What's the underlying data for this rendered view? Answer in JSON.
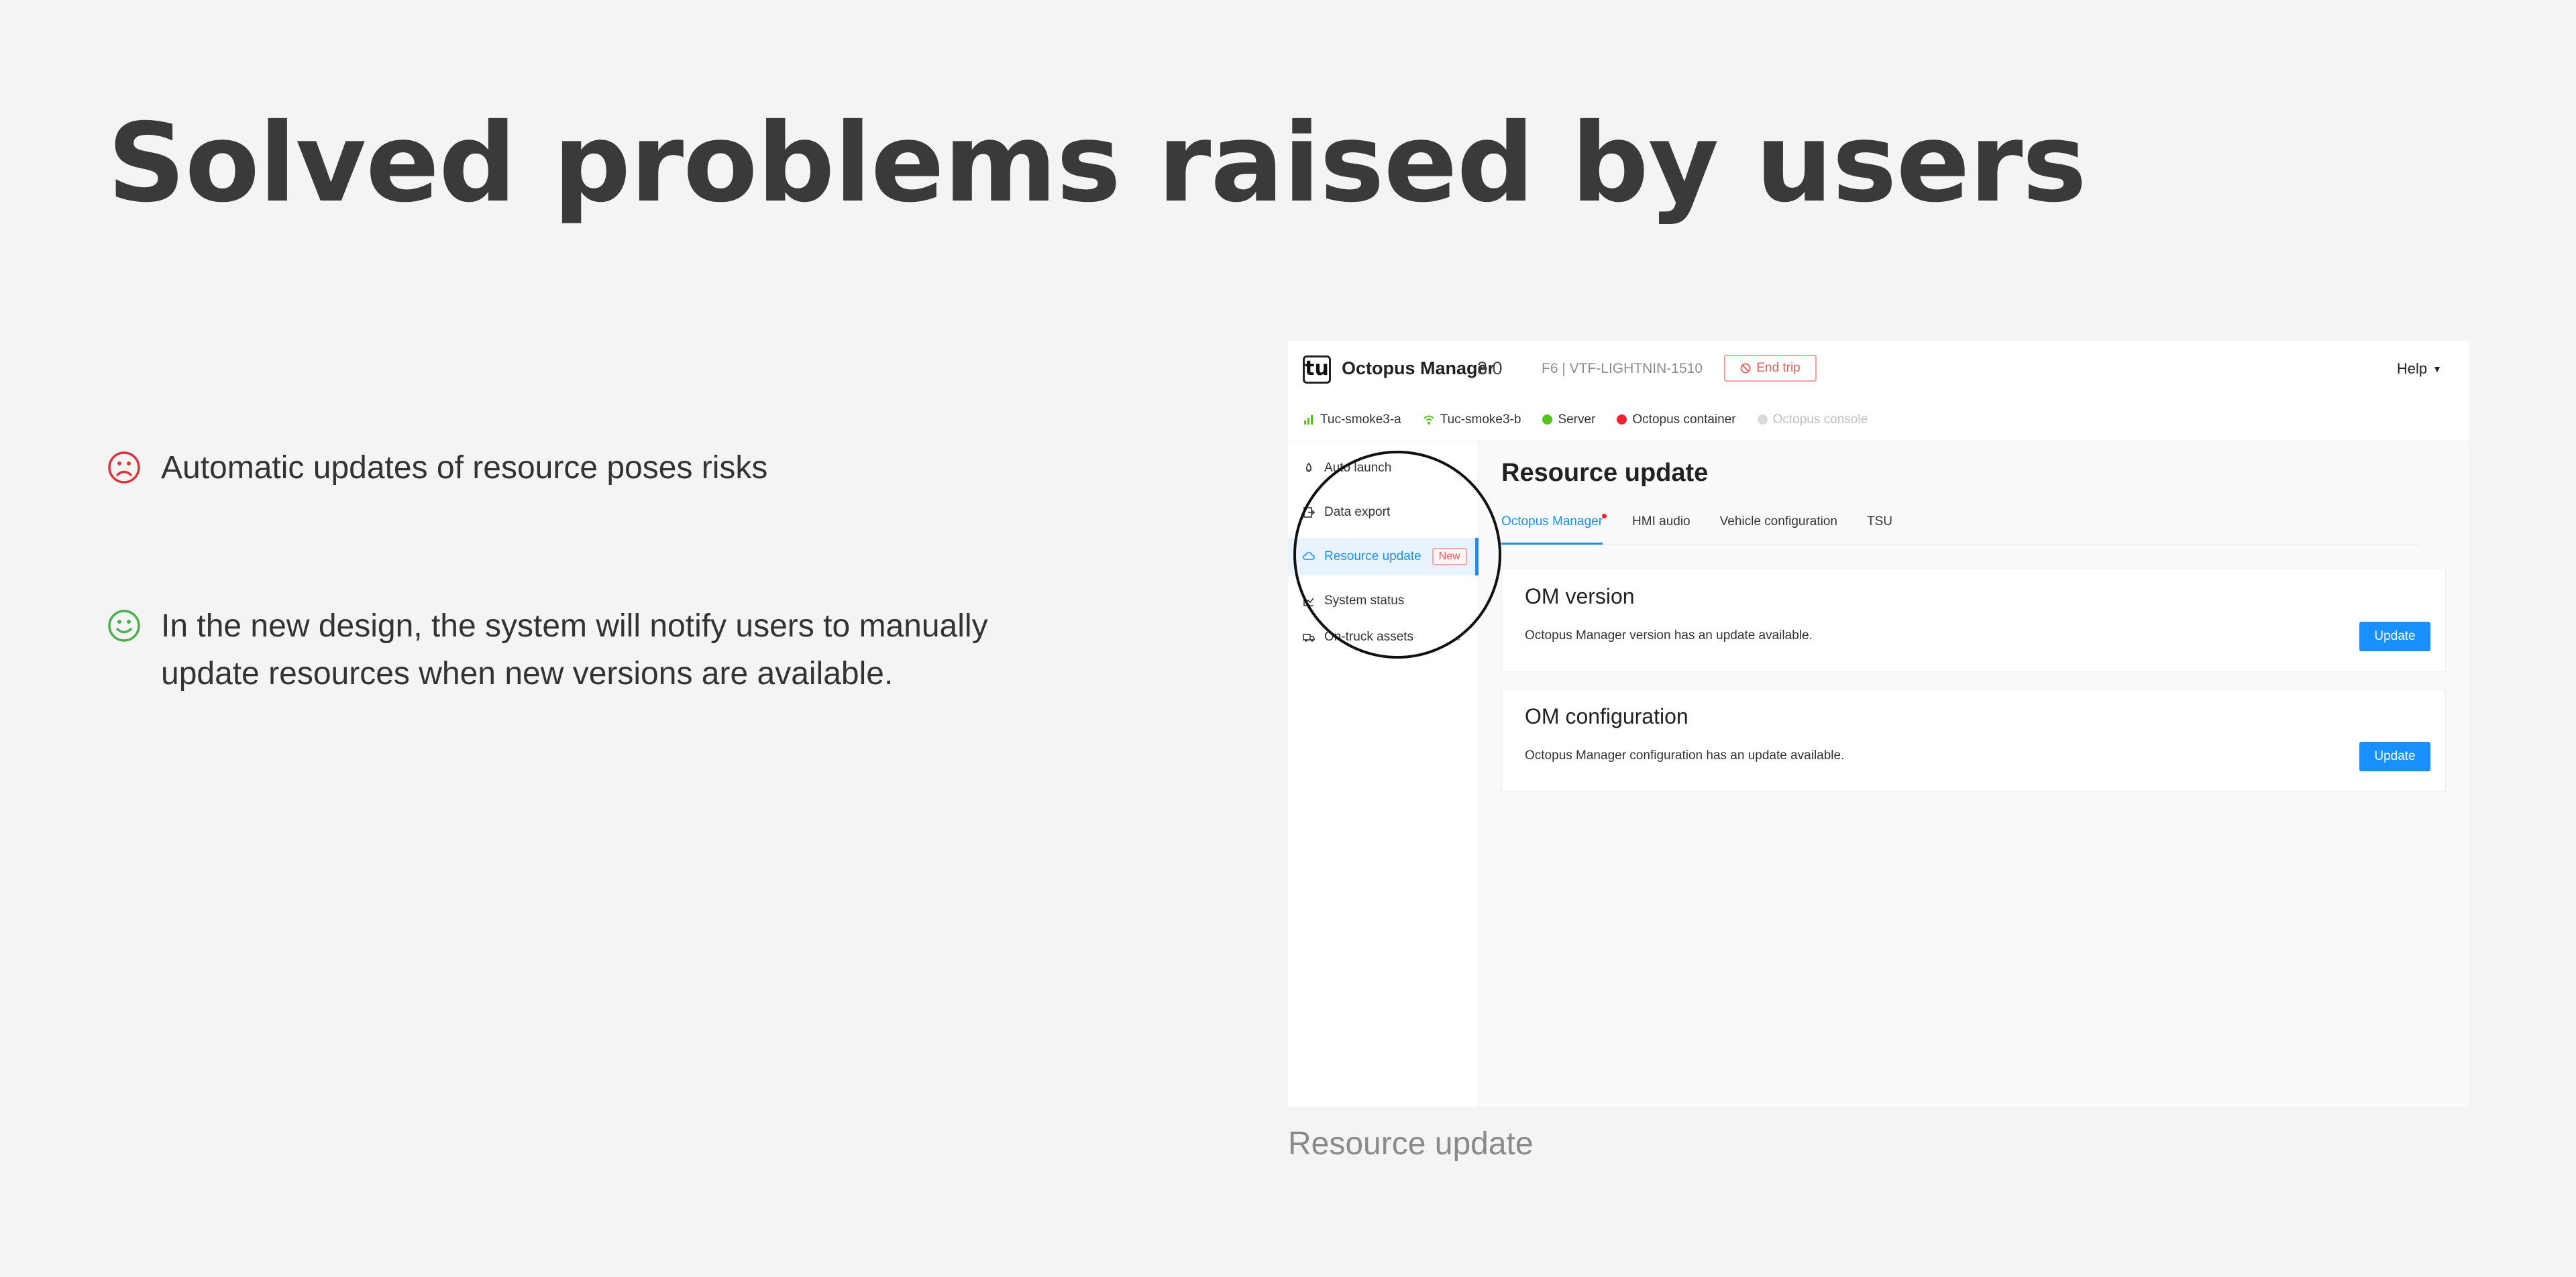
{
  "slide": {
    "title": "Solved problems raised by users",
    "points": [
      {
        "icon": "sad-face-icon",
        "text": "Automatic updates of resource poses risks"
      },
      {
        "icon": "happy-face-icon",
        "text": "In the new design, the system will notify users to manually update resources when new versions are available."
      }
    ],
    "caption": "Resource update"
  },
  "app": {
    "logo": "tu",
    "name": "Octopus Manager",
    "version": "3.0",
    "vehicle": "F6 | VTF-LIGHTNIN-1510",
    "end_trip": "End trip",
    "help": "Help"
  },
  "status": [
    {
      "label": "Tuc-smoke3-a",
      "icon": "signal-bars-icon",
      "color": "#52c41a"
    },
    {
      "label": "Tuc-smoke3-b",
      "icon": "wifi-icon",
      "color": "#52c41a"
    },
    {
      "label": "Server",
      "icon": "check-circle-icon",
      "color": "#52c41a"
    },
    {
      "label": "Octopus container",
      "icon": "error-circle-icon",
      "color": "#f5222d"
    },
    {
      "label": "Octopus console",
      "icon": "inactive-dot-icon",
      "color": "#d9d9d9"
    }
  ],
  "sidebar": {
    "items": [
      {
        "label": "Auto launch",
        "icon": "rocket-icon"
      },
      {
        "label": "Data export",
        "icon": "export-icon"
      },
      {
        "label": "Resource update",
        "icon": "cloud-icon",
        "badge": "New",
        "active": true
      },
      {
        "label": "System status",
        "icon": "chart-icon"
      },
      {
        "label": "On-truck assets",
        "icon": "truck-icon"
      }
    ]
  },
  "main": {
    "title": "Resource update",
    "tabs": [
      {
        "label": "Octopus Manager",
        "active": true,
        "dot": true
      },
      {
        "label": "HMI audio"
      },
      {
        "label": "Vehicle configuration"
      },
      {
        "label": "TSU"
      }
    ],
    "cards": [
      {
        "title": "OM version",
        "desc": "Octopus Manager version has an update available.",
        "button": "Update"
      },
      {
        "title": "OM configuration",
        "desc": "Octopus Manager configuration has an update available.",
        "button": "Update"
      }
    ]
  },
  "colors": {
    "accent": "#1890ff",
    "danger": "#e35b5b",
    "success": "#52c41a",
    "sad": "#d9363e",
    "happy": "#4caf50"
  }
}
